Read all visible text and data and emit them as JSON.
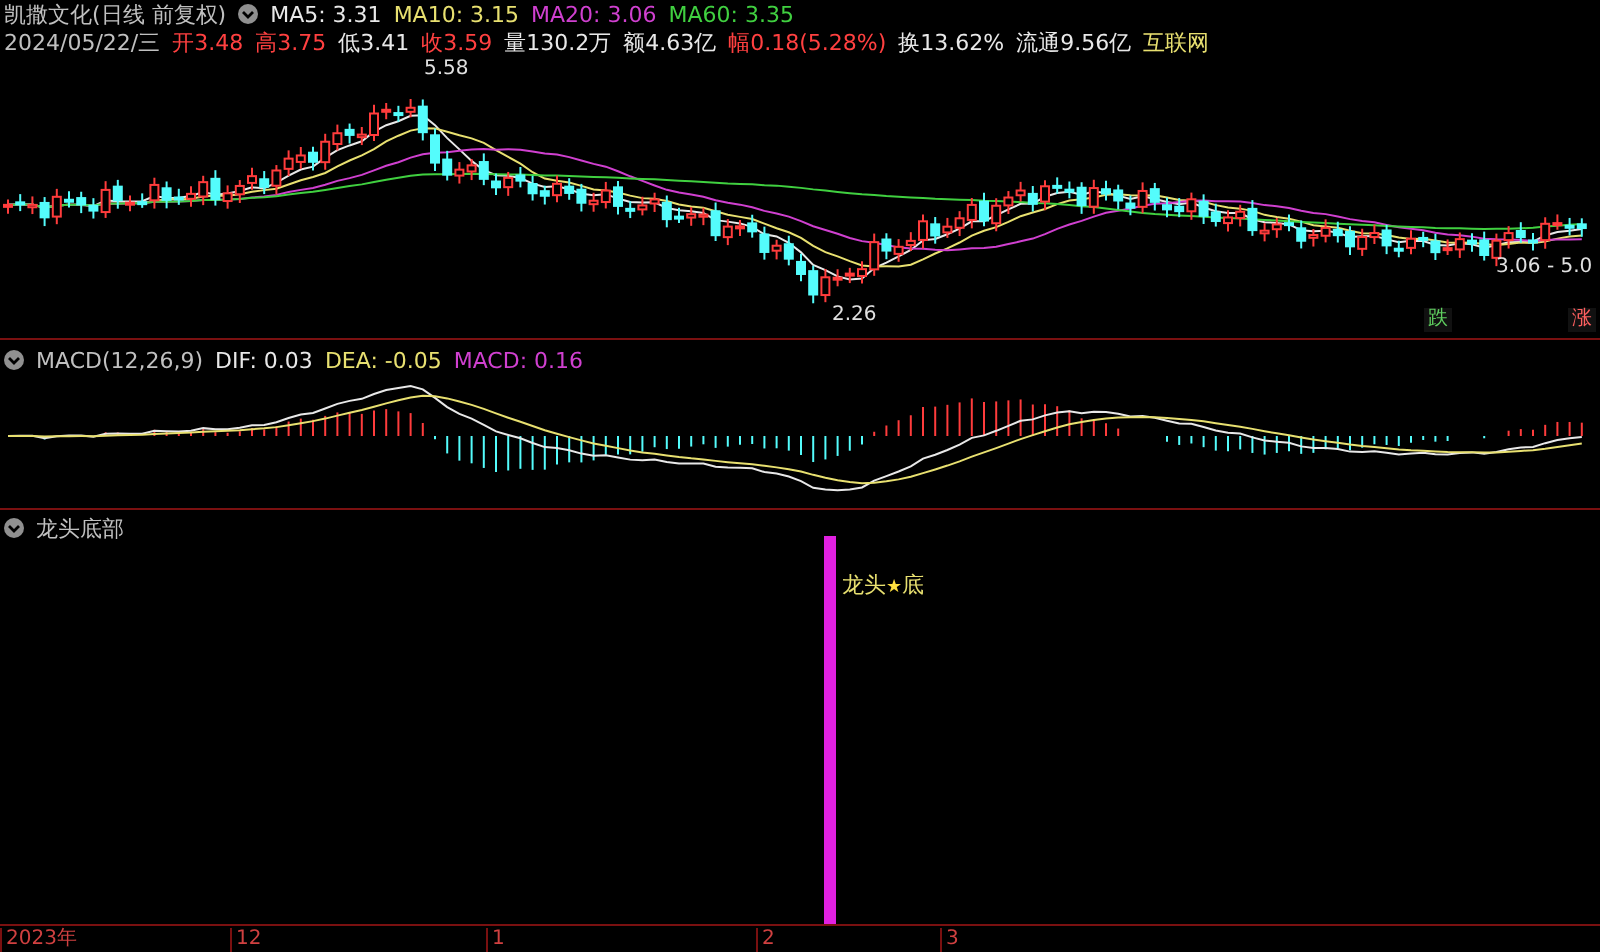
{
  "price_panel": {
    "title": "凯撒文化(日线 前复权)",
    "ma_legend": [
      {
        "label": "MA5: 3.31",
        "color": "#e8e8e8"
      },
      {
        "label": "MA10: 3.15",
        "color": "#e8e070"
      },
      {
        "label": "MA20: 3.06",
        "color": "#d040d0"
      },
      {
        "label": "MA60: 3.35",
        "color": "#40d040"
      }
    ],
    "date": "2024/05/22/三",
    "quote": [
      {
        "label": "开",
        "value": "3.48",
        "color": "#ff4040"
      },
      {
        "label": "高",
        "value": "3.75",
        "color": "#ff4040"
      },
      {
        "label": "低",
        "value": "3.41",
        "color": "#e8e8e8"
      },
      {
        "label": "收",
        "value": "3.59",
        "color": "#ff4040"
      },
      {
        "label": "量",
        "value": "130.2万",
        "color": "#e8e8e8"
      },
      {
        "label": "额",
        "value": "4.63亿",
        "color": "#e8e8e8"
      },
      {
        "label": "幅",
        "value": "0.18(5.28%)",
        "color": "#ff4040"
      },
      {
        "label": "换",
        "value": "13.62%",
        "color": "#e8e8e8"
      },
      {
        "label": "流通",
        "value": "9.56亿",
        "color": "#e8e8e8"
      }
    ],
    "sector": "互联网",
    "high_mark": "5.58",
    "low_mark": "2.26",
    "range_mark": "3.06 - 5.0",
    "fall_button": "跌",
    "rise_button": "涨"
  },
  "macd_panel": {
    "legend": [
      {
        "label": "MACD(12,26,9)",
        "color": "#c0c0c0"
      },
      {
        "label": "DIF: 0.03",
        "color": "#e8e8e8"
      },
      {
        "label": "DEA: -0.05",
        "color": "#e8e070"
      },
      {
        "label": "MACD: 0.16",
        "color": "#d040d0"
      }
    ]
  },
  "signal_panel": {
    "title": "龙头底部",
    "signal_label": {
      "before": "龙头",
      "star": "★",
      "after": "底"
    }
  },
  "time_axis": [
    {
      "label": "2023年"
    },
    {
      "label": "12"
    },
    {
      "label": "1"
    },
    {
      "label": "2"
    },
    {
      "label": "3"
    }
  ]
}
